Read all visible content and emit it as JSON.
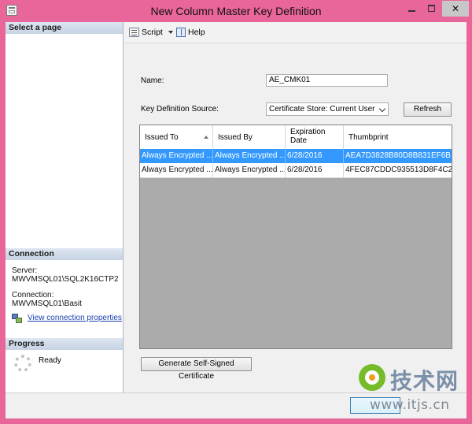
{
  "window": {
    "title": "New Column Master Key Definition"
  },
  "left_pane": {
    "select_page_header": "Select a page",
    "connection_header": "Connection",
    "server_label": "Server:",
    "server_value": "MWVMSQL01\\SQL2K16CTP2",
    "connection_label": "Connection:",
    "connection_value": "MWVMSQL01\\Basit",
    "view_properties_link": "View connection properties",
    "progress_header": "Progress",
    "progress_status": "Ready"
  },
  "toolbar": {
    "script_label": "Script",
    "help_label": "Help"
  },
  "form": {
    "name_label": "Name:",
    "name_value": "AE_CMK01",
    "source_label": "Key Definition Source:",
    "source_selected": "Certificate Store: Current User",
    "refresh_label": "Refresh",
    "generate_label": "Generate Self-Signed Certificate"
  },
  "grid": {
    "columns": [
      "Issued To",
      "Issued By",
      "Expiration\nDate",
      "Thumbprint"
    ],
    "rows": [
      {
        "issued_to": "Always Encrypted ...",
        "issued_by": "Always Encrypted ...",
        "expiration": "6/28/2016",
        "thumbprint": "AEA7D3828B80D8B831EF6B...",
        "selected": true
      },
      {
        "issued_to": "Always Encrypted ...",
        "issued_by": "Always Encrypted ...",
        "expiration": "6/28/2016",
        "thumbprint": "4FEC87CDDC935513D8F4C2...",
        "selected": false
      }
    ]
  },
  "watermark": {
    "brand_cn": "技术网",
    "url": "www.itjs.cn"
  },
  "colors": {
    "window_frame": "#e9669a",
    "selection": "#3399ff",
    "link": "#1a3faf"
  }
}
